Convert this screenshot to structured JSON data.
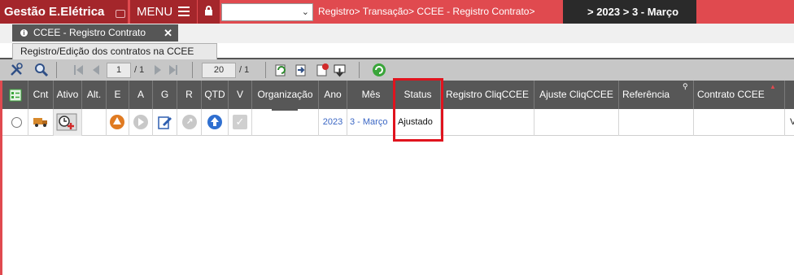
{
  "topbar": {
    "app_title": "Gestão E.Elétrica",
    "menu_label": "MENU",
    "breadcrumb": "Registro> Transação> CCEE - Registro Contrato>",
    "period": "> 2023 > 3 - Março",
    "colors": {
      "accent": "#e04a4f",
      "accent_dark": "#a4262b",
      "period_bg": "#2a2a2a"
    }
  },
  "tabs": {
    "main_tab": "CCEE - Registro Contrato",
    "sub_tab": "Registro/Edição dos contratos na CCEE"
  },
  "pager": {
    "page": "1",
    "pages_label": "/ 1",
    "page_size": "20",
    "size_total_label": "/ 1"
  },
  "grid": {
    "columns": [
      "Cnt",
      "Ativo",
      "Alt.",
      "E",
      "A",
      "G",
      "R",
      "QTD",
      "V",
      "Organização",
      "Ano",
      "Mês",
      "Status",
      "Registro CliqCCEE",
      "Ajuste CliqCCEE",
      "Referência",
      "Contrato CCEE"
    ],
    "rows": [
      {
        "ano": "2023",
        "mes": "3 - Março",
        "status": "Ajustado",
        "tail": "V"
      }
    ]
  }
}
